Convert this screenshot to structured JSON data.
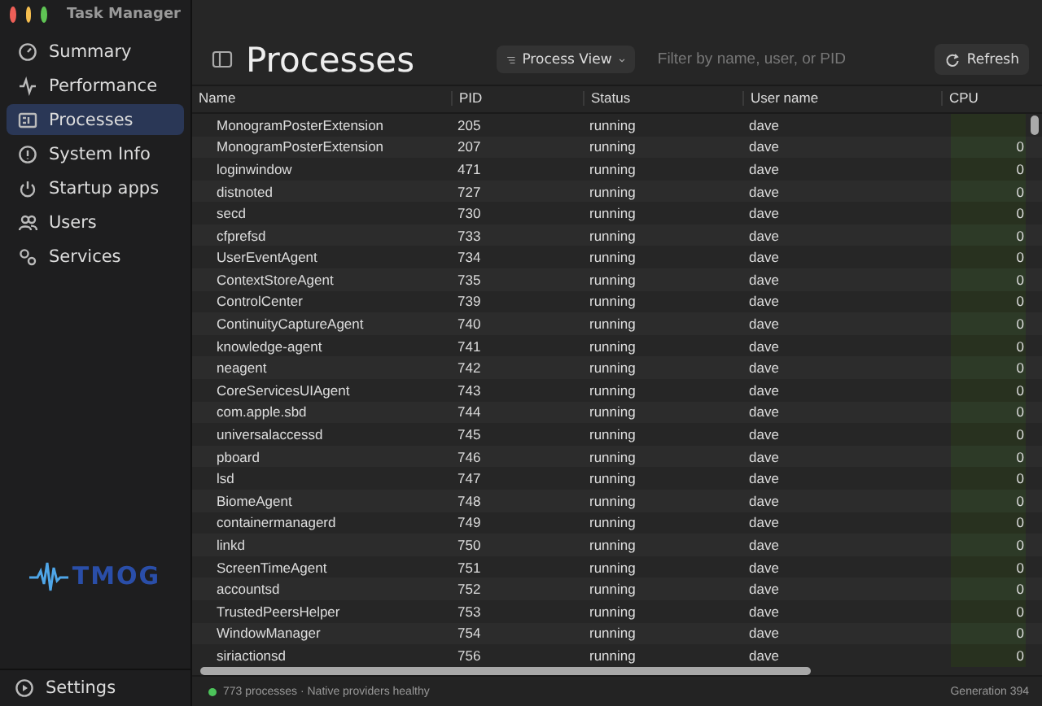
{
  "window": {
    "title": "Task Manager"
  },
  "sidebar": {
    "items": [
      {
        "label": "Summary",
        "selected": false
      },
      {
        "label": "Performance",
        "selected": false
      },
      {
        "label": "Processes",
        "selected": true
      },
      {
        "label": "System Info",
        "selected": false
      },
      {
        "label": "Startup apps",
        "selected": false
      },
      {
        "label": "Users",
        "selected": false
      },
      {
        "label": "Services",
        "selected": false
      }
    ],
    "logo": "TMOG",
    "settings": "Settings"
  },
  "header": {
    "title": "Processes",
    "view_menu": "Process View",
    "filter": {
      "placeholder": "Filter by name, user, or PID"
    },
    "refresh": "Refresh"
  },
  "table": {
    "columns": [
      "Name",
      "PID",
      "Status",
      "User name",
      "CPU"
    ],
    "rows": [
      {
        "name": "MonogramPosterExtension",
        "pid": "205",
        "status": "running",
        "user": "dave"
      },
      {
        "name": "MonogramPosterExtension",
        "pid": "207",
        "status": "running",
        "user": "dave",
        "cpu": "0"
      },
      {
        "name": "loginwindow",
        "pid": "471",
        "status": "running",
        "user": "dave",
        "cpu": "0"
      },
      {
        "name": "distnoted",
        "pid": "727",
        "status": "running",
        "user": "dave",
        "cpu": "0"
      },
      {
        "name": "secd",
        "pid": "730",
        "status": "running",
        "user": "dave",
        "cpu": "0"
      },
      {
        "name": "cfprefsd",
        "pid": "733",
        "status": "running",
        "user": "dave",
        "cpu": "0"
      },
      {
        "name": "UserEventAgent",
        "pid": "734",
        "status": "running",
        "user": "dave",
        "cpu": "0"
      },
      {
        "name": "ContextStoreAgent",
        "pid": "735",
        "status": "running",
        "user": "dave",
        "cpu": "0"
      },
      {
        "name": "ControlCenter",
        "pid": "739",
        "status": "running",
        "user": "dave",
        "cpu": "0"
      },
      {
        "name": "ContinuityCaptureAgent",
        "pid": "740",
        "status": "running",
        "user": "dave",
        "cpu": "0"
      },
      {
        "name": "knowledge-agent",
        "pid": "741",
        "status": "running",
        "user": "dave",
        "cpu": "0"
      },
      {
        "name": "neagent",
        "pid": "742",
        "status": "running",
        "user": "dave",
        "cpu": "0"
      },
      {
        "name": "CoreServicesUIAgent",
        "pid": "743",
        "status": "running",
        "user": "dave",
        "cpu": "0"
      },
      {
        "name": "com.apple.sbd",
        "pid": "744",
        "status": "running",
        "user": "dave",
        "cpu": "0"
      },
      {
        "name": "universalaccessd",
        "pid": "745",
        "status": "running",
        "user": "dave",
        "cpu": "0"
      },
      {
        "name": "pboard",
        "pid": "746",
        "status": "running",
        "user": "dave",
        "cpu": "0"
      },
      {
        "name": "lsd",
        "pid": "747",
        "status": "running",
        "user": "dave",
        "cpu": "0"
      },
      {
        "name": "BiomeAgent",
        "pid": "748",
        "status": "running",
        "user": "dave",
        "cpu": "0"
      },
      {
        "name": "containermanagerd",
        "pid": "749",
        "status": "running",
        "user": "dave",
        "cpu": "0"
      },
      {
        "name": "linkd",
        "pid": "750",
        "status": "running",
        "user": "dave",
        "cpu": "0"
      },
      {
        "name": "ScreenTimeAgent",
        "pid": "751",
        "status": "running",
        "user": "dave",
        "cpu": "0"
      },
      {
        "name": "accountsd",
        "pid": "752",
        "status": "running",
        "user": "dave",
        "cpu": "0"
      },
      {
        "name": "TrustedPeersHelper",
        "pid": "753",
        "status": "running",
        "user": "dave",
        "cpu": "0"
      },
      {
        "name": "WindowManager",
        "pid": "754",
        "status": "running",
        "user": "dave",
        "cpu": "0"
      },
      {
        "name": "siriactionsd",
        "pid": "756",
        "status": "running",
        "user": "dave",
        "cpu": "0"
      }
    ]
  },
  "status_bar": {
    "healthy": true,
    "text": "773 processes · Native providers healthy",
    "generation": "Generation 394"
  }
}
